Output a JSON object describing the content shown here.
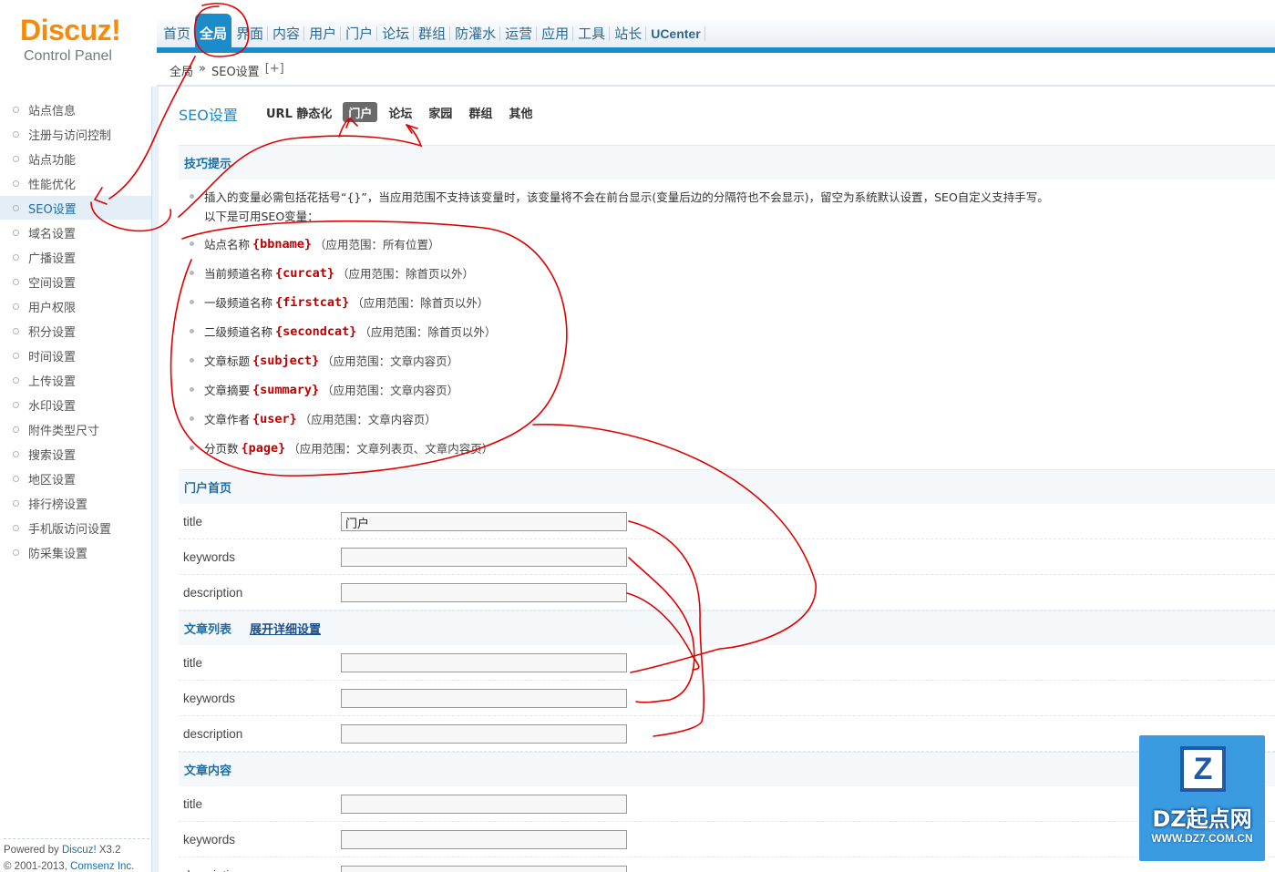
{
  "header": {
    "logo": {
      "mark": "Discuz!",
      "sub": "Control Panel"
    },
    "topnav": [
      "首页",
      "全局",
      "界面",
      "内容",
      "用户",
      "门户",
      "论坛",
      "群组",
      "防灌水",
      "运营",
      "应用",
      "工具",
      "站长",
      "UCenter"
    ],
    "active_topnav": "全局",
    "breadcrumb": {
      "root": "全局",
      "sep": "»",
      "current": "SEO设置",
      "add": "[+]"
    }
  },
  "sidebar": {
    "items": [
      "站点信息",
      "注册与访问控制",
      "站点功能",
      "性能优化",
      "SEO设置",
      "域名设置",
      "广播设置",
      "空间设置",
      "用户权限",
      "积分设置",
      "时间设置",
      "上传设置",
      "水印设置",
      "附件类型尺寸",
      "搜索设置",
      "地区设置",
      "排行榜设置",
      "手机版访问设置",
      "防采集设置"
    ],
    "active": "SEO设置",
    "footer": {
      "powered": "Powered by",
      "product": "Discuz!",
      "version": "X3.2",
      "copyright": "© 2001-2013,",
      "company": "Comsenz Inc."
    }
  },
  "main": {
    "title": "SEO设置",
    "subtabs": [
      "URL 静态化",
      "门户",
      "论坛",
      "家园",
      "群组",
      "其他"
    ],
    "active_subtab": "门户",
    "tips": {
      "heading": "技巧提示",
      "intro": "插入的变量必需包括花括号“{}”，当应用范围不支持该变量时，该变量将不会在前台显示(变量后边的分隔符也不会显示)，留空为系统默认设置，SEO自定义支持手写。",
      "intro2": "以下是可用SEO变量：",
      "vars": [
        {
          "name": "站点名称",
          "var": "{bbname}",
          "scope": "（应用范围：所有位置）"
        },
        {
          "name": "当前频道名称",
          "var": "{curcat}",
          "scope": "（应用范围：除首页以外）"
        },
        {
          "name": "一级频道名称",
          "var": "{firstcat}",
          "scope": "（应用范围：除首页以外）"
        },
        {
          "name": "二级频道名称",
          "var": "{secondcat}",
          "scope": "（应用范围：除首页以外）"
        },
        {
          "name": "文章标题",
          "var": "{subject}",
          "scope": "（应用范围：文章内容页）"
        },
        {
          "name": "文章摘要",
          "var": "{summary}",
          "scope": "（应用范围：文章内容页）"
        },
        {
          "name": "文章作者",
          "var": "{user}",
          "scope": "（应用范围：文章内容页）"
        },
        {
          "name": "分页数",
          "var": "{page}",
          "scope": "（应用范围：文章列表页、文章内容页）"
        }
      ]
    },
    "sections": [
      {
        "heading": "门户首页",
        "expand": "",
        "fields": [
          {
            "key": "title",
            "value": "门户"
          },
          {
            "key": "keywords",
            "value": ""
          },
          {
            "key": "description",
            "value": ""
          }
        ]
      },
      {
        "heading": "文章列表",
        "expand": "展开详细设置",
        "fields": [
          {
            "key": "title",
            "value": ""
          },
          {
            "key": "keywords",
            "value": ""
          },
          {
            "key": "description",
            "value": ""
          }
        ]
      },
      {
        "heading": "文章内容",
        "expand": "",
        "fields": [
          {
            "key": "title",
            "value": ""
          },
          {
            "key": "keywords",
            "value": ""
          },
          {
            "key": "description",
            "value": ""
          }
        ]
      }
    ]
  },
  "watermark": {
    "mark": "Z",
    "name": "DZ起点网",
    "url": "WWW.DZ7.COM.CN"
  },
  "colors": {
    "accent": "#1b8bca",
    "logo": "#f68a0a",
    "variable": "#c00000",
    "annotation": "#e00000"
  }
}
